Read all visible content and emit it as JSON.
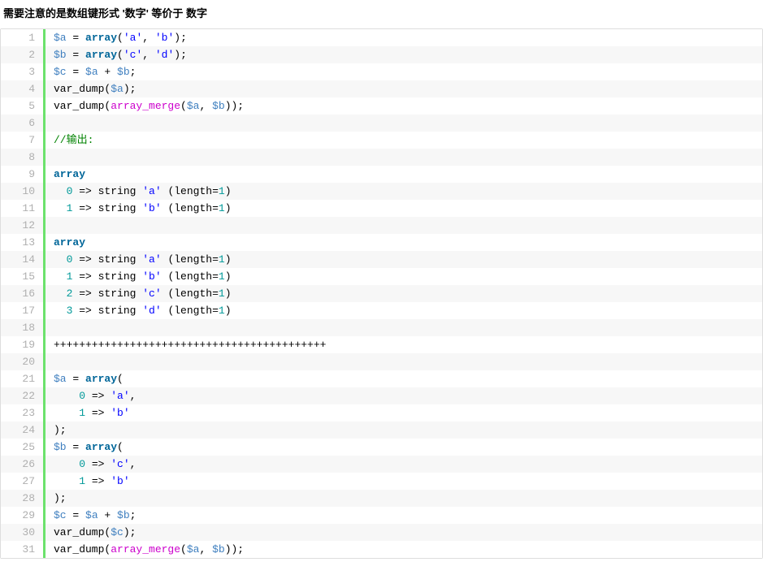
{
  "heading": "需要注意的是数组键形式 '数字' 等价于 数字",
  "code": {
    "lines": [
      {
        "n": 1,
        "tokens": [
          [
            "var",
            "$a"
          ],
          [
            "p",
            " = "
          ],
          [
            "kw",
            "array"
          ],
          [
            "p",
            "("
          ],
          [
            "str",
            "'a'"
          ],
          [
            "p",
            ", "
          ],
          [
            "str",
            "'b'"
          ],
          [
            "p",
            ");"
          ]
        ]
      },
      {
        "n": 2,
        "tokens": [
          [
            "var",
            "$b"
          ],
          [
            "p",
            " = "
          ],
          [
            "kw",
            "array"
          ],
          [
            "p",
            "("
          ],
          [
            "str",
            "'c'"
          ],
          [
            "p",
            ", "
          ],
          [
            "str",
            "'d'"
          ],
          [
            "p",
            ");"
          ]
        ]
      },
      {
        "n": 3,
        "tokens": [
          [
            "var",
            "$c"
          ],
          [
            "p",
            " = "
          ],
          [
            "var",
            "$a"
          ],
          [
            "p",
            " + "
          ],
          [
            "var",
            "$b"
          ],
          [
            "p",
            ";"
          ]
        ]
      },
      {
        "n": 4,
        "tokens": [
          [
            "p",
            "var_dump("
          ],
          [
            "var",
            "$a"
          ],
          [
            "p",
            ");"
          ]
        ]
      },
      {
        "n": 5,
        "tokens": [
          [
            "p",
            "var_dump("
          ],
          [
            "fn",
            "array_merge"
          ],
          [
            "p",
            "("
          ],
          [
            "var",
            "$a"
          ],
          [
            "p",
            ", "
          ],
          [
            "var",
            "$b"
          ],
          [
            "p",
            "));"
          ]
        ]
      },
      {
        "n": 6,
        "tokens": []
      },
      {
        "n": 7,
        "tokens": [
          [
            "cmt",
            "//输出:"
          ]
        ]
      },
      {
        "n": 8,
        "tokens": []
      },
      {
        "n": 9,
        "tokens": [
          [
            "kw",
            "array"
          ]
        ]
      },
      {
        "n": 10,
        "tokens": [
          [
            "p",
            "  "
          ],
          [
            "num",
            "0"
          ],
          [
            "p",
            " => string "
          ],
          [
            "str",
            "'a'"
          ],
          [
            "p",
            " (length="
          ],
          [
            "num",
            "1"
          ],
          [
            "p",
            ")"
          ]
        ]
      },
      {
        "n": 11,
        "tokens": [
          [
            "p",
            "  "
          ],
          [
            "num",
            "1"
          ],
          [
            "p",
            " => string "
          ],
          [
            "str",
            "'b'"
          ],
          [
            "p",
            " (length="
          ],
          [
            "num",
            "1"
          ],
          [
            "p",
            ")"
          ]
        ]
      },
      {
        "n": 12,
        "tokens": []
      },
      {
        "n": 13,
        "tokens": [
          [
            "kw",
            "array"
          ]
        ]
      },
      {
        "n": 14,
        "tokens": [
          [
            "p",
            "  "
          ],
          [
            "num",
            "0"
          ],
          [
            "p",
            " => string "
          ],
          [
            "str",
            "'a'"
          ],
          [
            "p",
            " (length="
          ],
          [
            "num",
            "1"
          ],
          [
            "p",
            ")"
          ]
        ]
      },
      {
        "n": 15,
        "tokens": [
          [
            "p",
            "  "
          ],
          [
            "num",
            "1"
          ],
          [
            "p",
            " => string "
          ],
          [
            "str",
            "'b'"
          ],
          [
            "p",
            " (length="
          ],
          [
            "num",
            "1"
          ],
          [
            "p",
            ")"
          ]
        ]
      },
      {
        "n": 16,
        "tokens": [
          [
            "p",
            "  "
          ],
          [
            "num",
            "2"
          ],
          [
            "p",
            " => string "
          ],
          [
            "str",
            "'c'"
          ],
          [
            "p",
            " (length="
          ],
          [
            "num",
            "1"
          ],
          [
            "p",
            ")"
          ]
        ]
      },
      {
        "n": 17,
        "tokens": [
          [
            "p",
            "  "
          ],
          [
            "num",
            "3"
          ],
          [
            "p",
            " => string "
          ],
          [
            "str",
            "'d'"
          ],
          [
            "p",
            " (length="
          ],
          [
            "num",
            "1"
          ],
          [
            "p",
            ")"
          ]
        ]
      },
      {
        "n": 18,
        "tokens": []
      },
      {
        "n": 19,
        "tokens": [
          [
            "p",
            "+++++++++++++++++++++++++++++++++++++++++++"
          ]
        ]
      },
      {
        "n": 20,
        "tokens": []
      },
      {
        "n": 21,
        "tokens": [
          [
            "var",
            "$a"
          ],
          [
            "p",
            " = "
          ],
          [
            "kw",
            "array"
          ],
          [
            "p",
            "("
          ]
        ]
      },
      {
        "n": 22,
        "tokens": [
          [
            "p",
            "    "
          ],
          [
            "num",
            "0"
          ],
          [
            "p",
            " => "
          ],
          [
            "str",
            "'a'"
          ],
          [
            "p",
            ","
          ]
        ]
      },
      {
        "n": 23,
        "tokens": [
          [
            "p",
            "    "
          ],
          [
            "num",
            "1"
          ],
          [
            "p",
            " => "
          ],
          [
            "str",
            "'b'"
          ]
        ]
      },
      {
        "n": 24,
        "tokens": [
          [
            "p",
            ");"
          ]
        ]
      },
      {
        "n": 25,
        "tokens": [
          [
            "var",
            "$b"
          ],
          [
            "p",
            " = "
          ],
          [
            "kw",
            "array"
          ],
          [
            "p",
            "("
          ]
        ]
      },
      {
        "n": 26,
        "tokens": [
          [
            "p",
            "    "
          ],
          [
            "num",
            "0"
          ],
          [
            "p",
            " => "
          ],
          [
            "str",
            "'c'"
          ],
          [
            "p",
            ","
          ]
        ]
      },
      {
        "n": 27,
        "tokens": [
          [
            "p",
            "    "
          ],
          [
            "num",
            "1"
          ],
          [
            "p",
            " => "
          ],
          [
            "str",
            "'b'"
          ]
        ]
      },
      {
        "n": 28,
        "tokens": [
          [
            "p",
            ");"
          ]
        ]
      },
      {
        "n": 29,
        "tokens": [
          [
            "var",
            "$c"
          ],
          [
            "p",
            " = "
          ],
          [
            "var",
            "$a"
          ],
          [
            "p",
            " + "
          ],
          [
            "var",
            "$b"
          ],
          [
            "p",
            ";"
          ]
        ]
      },
      {
        "n": 30,
        "tokens": [
          [
            "p",
            "var_dump("
          ],
          [
            "var",
            "$c"
          ],
          [
            "p",
            ");"
          ]
        ]
      },
      {
        "n": 31,
        "tokens": [
          [
            "p",
            "var_dump("
          ],
          [
            "fn",
            "array_merge"
          ],
          [
            "p",
            "("
          ],
          [
            "var",
            "$a"
          ],
          [
            "p",
            ", "
          ],
          [
            "var",
            "$b"
          ],
          [
            "p",
            "));"
          ]
        ]
      }
    ]
  }
}
